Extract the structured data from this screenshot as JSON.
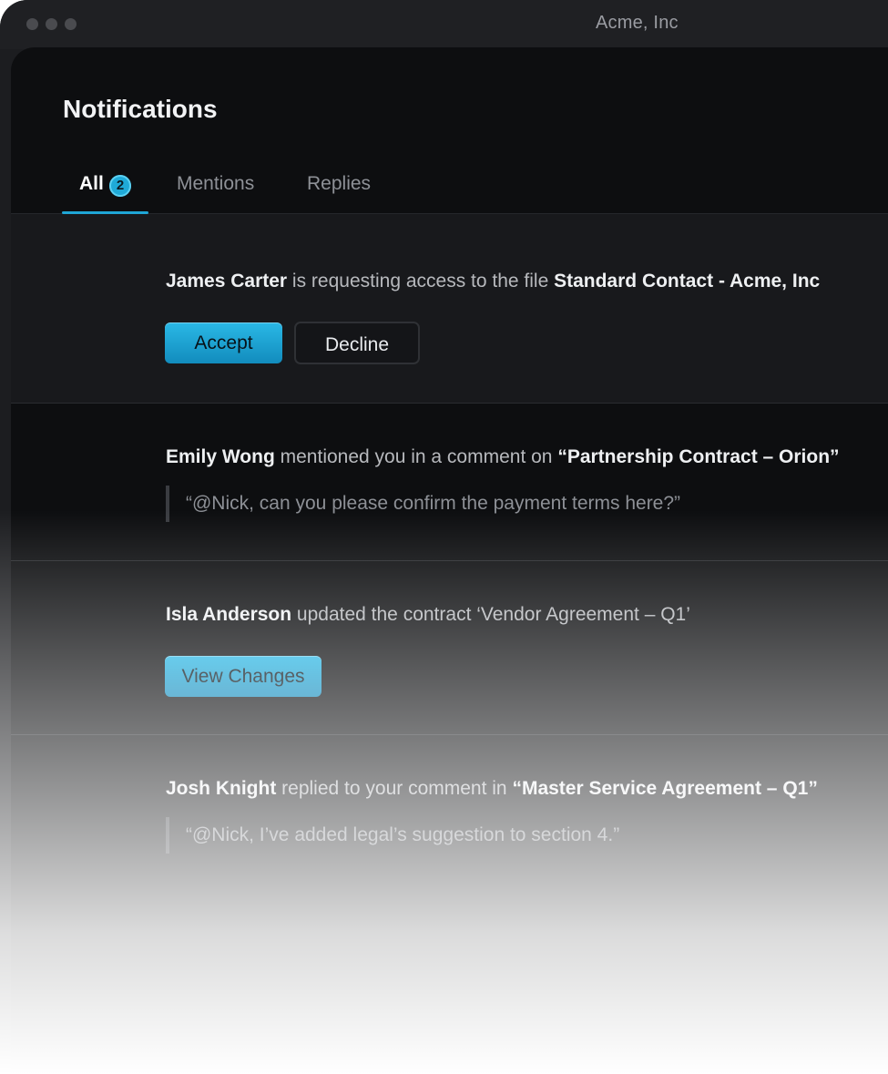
{
  "window": {
    "title": "Acme, Inc"
  },
  "page": {
    "title": "Notifications"
  },
  "tabs": [
    {
      "label": "All",
      "badge": "2",
      "active": true
    },
    {
      "label": "Mentions",
      "active": false
    },
    {
      "label": "Replies",
      "active": false
    }
  ],
  "notifications": [
    {
      "actor": "James Carter",
      "text": " is requesting access to the file ",
      "object": "Standard Contact - Acme, Inc",
      "actions": {
        "accept": "Accept",
        "decline": "Decline"
      }
    },
    {
      "actor": "Emily Wong",
      "text": " mentioned you in a comment on ",
      "object": "“Partnership Contract – Orion”",
      "quote": "“@Nick, can you please confirm the payment terms here?”"
    },
    {
      "actor": "Isla Anderson",
      "text": " updated the contract ‘Vendor Agreement – Q1’",
      "actions": {
        "view": "View Changes"
      }
    },
    {
      "actor": "Josh Knight",
      "text": " replied to your comment in ",
      "object": "“Master Service Agreement – Q1”",
      "quote": "“@Nick, I’ve added legal’s suggestion to section 4.”"
    }
  ],
  "colors": {
    "accent": "#1fa6d6",
    "background": "#0d0e10",
    "titlebar": "#1f2023"
  }
}
